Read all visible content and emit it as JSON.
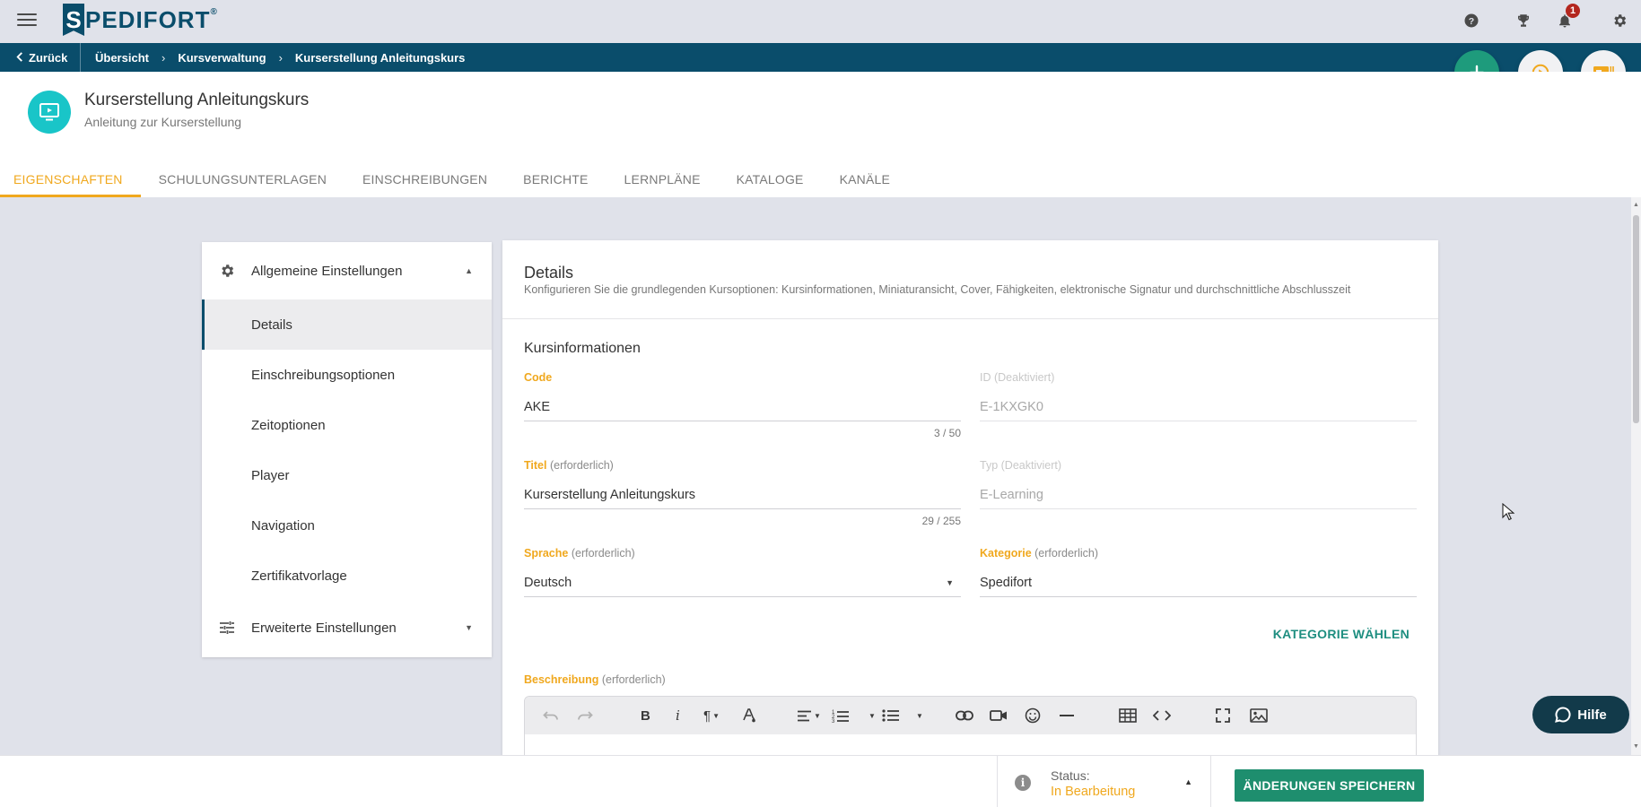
{
  "app": {
    "brand_initial": "S",
    "brand_rest": "PEDIFORT",
    "brand_reg": "®",
    "notification_count": "1"
  },
  "breadcrumb": {
    "back_label": "Zurück",
    "items": [
      "Übersicht",
      "Kursverwaltung",
      "Kurserstellung Anleitungskurs"
    ],
    "separator": "›"
  },
  "course": {
    "title": "Kurserstellung Anleitungskurs",
    "subtitle": "Anleitung zur Kurserstellung"
  },
  "tabs": [
    {
      "label": "Eigenschaften",
      "active": true
    },
    {
      "label": "Schulungsunterlagen",
      "active": false
    },
    {
      "label": "Einschreibungen",
      "active": false
    },
    {
      "label": "Berichte",
      "active": false
    },
    {
      "label": "Lernpläne",
      "active": false
    },
    {
      "label": "Kataloge",
      "active": false
    },
    {
      "label": "Kanäle",
      "active": false
    }
  ],
  "settings_panel": {
    "general_label": "Allgemeine Einstellungen",
    "items": [
      "Details",
      "Einschreibungsoptionen",
      "Zeitoptionen",
      "Player",
      "Navigation",
      "Zertifikatvorlage"
    ],
    "active_item": "Details",
    "advanced_label": "Erweiterte Einstellungen"
  },
  "details": {
    "title": "Details",
    "description": "Konfigurieren Sie die grundlegenden Kursoptionen: Kursinformationen, Miniaturansicht, Cover, Fähigkeiten, elektronische Signatur und durchschnittliche Abschlusszeit",
    "section_title": "Kursinformationen",
    "fields": {
      "code": {
        "label": "Code",
        "note": "",
        "value": "AKE",
        "counter": "3 / 50"
      },
      "id": {
        "label": "ID",
        "note": "(Deaktiviert)",
        "value": "E-1KXGK0"
      },
      "title": {
        "label": "Titel",
        "note": "(erforderlich)",
        "value": "Kurserstellung Anleitungskurs",
        "counter": "29 / 255"
      },
      "type": {
        "label": "Typ",
        "note": "(Deaktiviert)",
        "value": "E-Learning"
      },
      "language": {
        "label": "Sprache",
        "note": "(erforderlich)",
        "value": "Deutsch"
      },
      "category": {
        "label": "Kategorie",
        "note": "(erforderlich)",
        "value": "Spedifort"
      }
    },
    "choose_category_label": "Kategorie wählen",
    "description_field": {
      "label": "Beschreibung",
      "note": "(erforderlich)"
    }
  },
  "editor_toolbar": {
    "bold": "B",
    "italic": "i",
    "paragraph": "¶"
  },
  "status": {
    "label": "Status:",
    "value": "In Bearbeitung"
  },
  "save_label": "Änderungen speichern",
  "help_label": "Hilfe",
  "colors": {
    "brand_dark": "#0a4d6b",
    "accent": "#f0a81e",
    "primary_green": "#1e8e6e",
    "fab_green": "#1e9b7c",
    "course_icon": "#19c5c8",
    "help_bg": "#123a4a"
  }
}
